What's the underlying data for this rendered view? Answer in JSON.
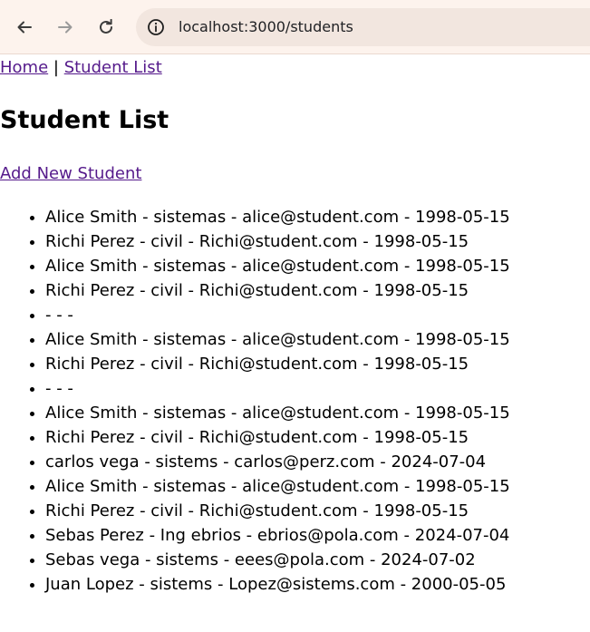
{
  "browser": {
    "url": "localhost:3000/students",
    "icons": {
      "back": "arrow-left-icon",
      "forward": "arrow-right-icon",
      "reload": "reload-icon",
      "site_info": "info-circle-icon"
    }
  },
  "nav": {
    "home": "Home",
    "separator": "|",
    "student_list": "Student List"
  },
  "page": {
    "title": "Student List",
    "add_link": "Add New Student"
  },
  "students": [
    "Alice Smith - sistemas - alice@student.com - 1998-05-15",
    "Richi Perez - civil - Richi@student.com - 1998-05-15",
    "Alice Smith - sistemas - alice@student.com - 1998-05-15",
    "Richi Perez - civil - Richi@student.com - 1998-05-15",
    "- - -",
    "Alice Smith - sistemas - alice@student.com - 1998-05-15",
    "Richi Perez - civil - Richi@student.com - 1998-05-15",
    "- - -",
    "Alice Smith - sistemas - alice@student.com - 1998-05-15",
    "Richi Perez - civil - Richi@student.com - 1998-05-15",
    "carlos vega - sistems - carlos@perz.com - 2024-07-04",
    "Alice Smith - sistemas - alice@student.com - 1998-05-15",
    "Richi Perez - civil - Richi@student.com - 1998-05-15",
    "Sebas Perez - Ing ebrios - ebrios@pola.com - 2024-07-04",
    "Sebas vega - sistems - eees@pola.com - 2024-07-02",
    "Juan Lopez - sistems - Lopez@sistems.com - 2000-05-05"
  ],
  "colors": {
    "chrome_bg": "#fdf3ed",
    "omnibox_bg": "#f2e6df",
    "link": "#551a8b",
    "text": "#000000"
  }
}
